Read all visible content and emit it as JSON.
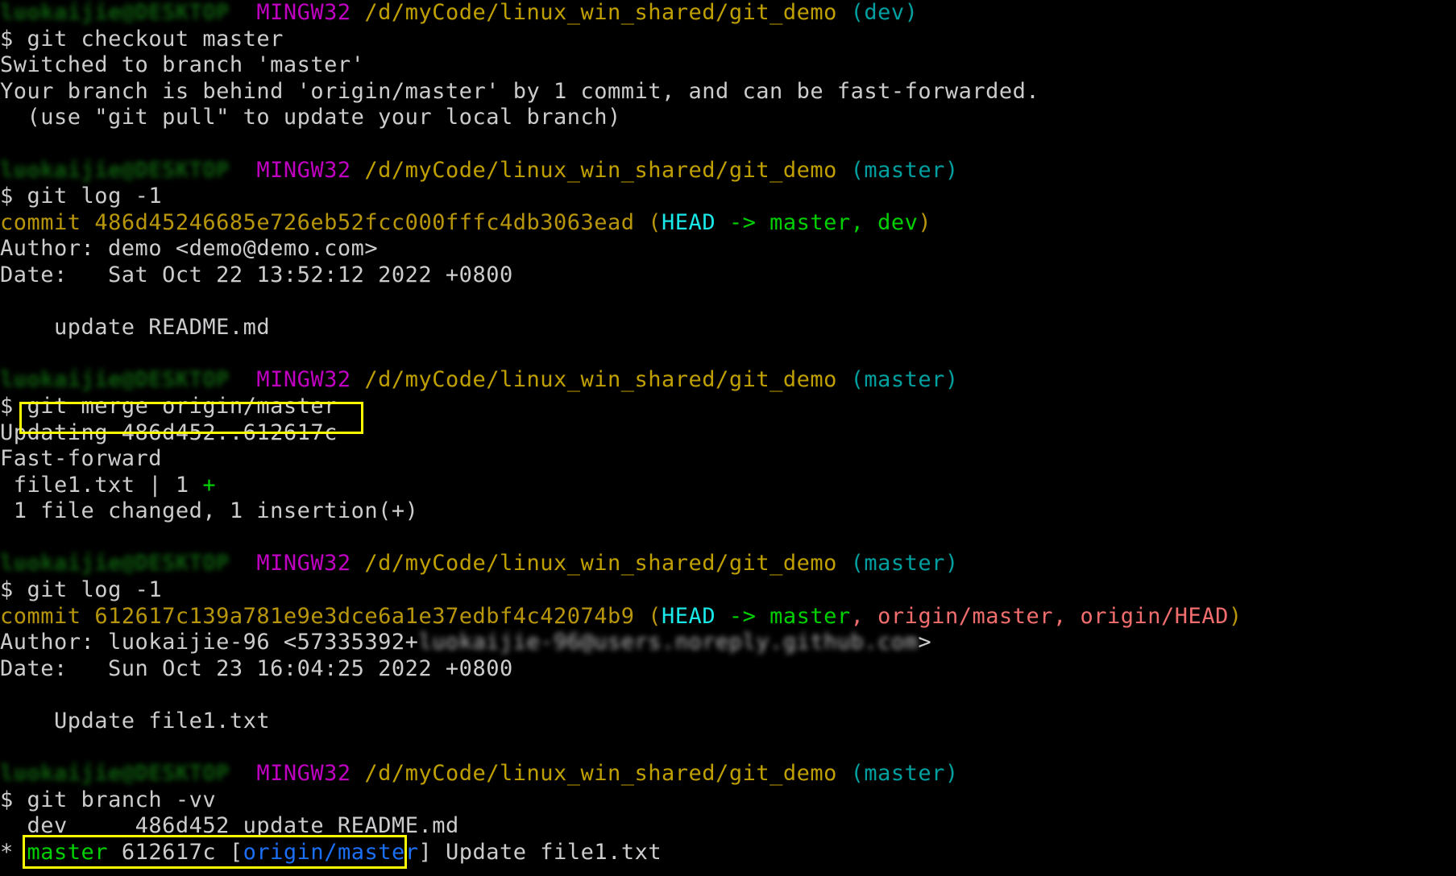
{
  "terminal": {
    "shell": "MINGW32",
    "path": "/d/myCode/linux_win_shared/git_demo",
    "prompt_symbol": "$",
    "redacted_user": "luokaijie@DESKTOP",
    "redacted_email": "luokaijie-96@users.noreply.github.com",
    "colors": {
      "background": "#000000",
      "foreground": "#ccccce",
      "user_green": "#00c000",
      "shell_purple": "#c000c0",
      "path_yellow": "#c0a000",
      "branch_teal": "#00a0a0",
      "commit_olive": "#b8960c",
      "head_cyan": "#18e8e8",
      "local_branch_green": "#00d000",
      "remote_branch_salmon": "#f26d6d",
      "tracking_blue": "#1b6ff5",
      "highlight_box": "#ffff00"
    },
    "annotations": [
      {
        "name": "merge-command-box",
        "label": "git merge origin/master"
      },
      {
        "name": "branch-tracking-box",
        "label": "master 612617c [origin/master]"
      }
    ],
    "blocks": [
      {
        "prompt_branch": "(dev)",
        "command": "git checkout master",
        "output": [
          "Switched to branch 'master'",
          "Your branch is behind 'origin/master' by 1 commit, and can be fast-forwarded.",
          "  (use \"git pull\" to update your local branch)"
        ]
      },
      {
        "prompt_branch": "(master)",
        "command": "git log -1",
        "commit_label": "commit",
        "commit_hash": "486d45246685e726eb52fcc000fffc4db3063ead",
        "refs_open": " (",
        "ref_head": "HEAD",
        "ref_arrow": " -> ",
        "ref_list": "master, dev",
        "refs_close": ")",
        "author_label": "Author: ",
        "author_value": "demo <demo@demo.com>",
        "date_label": "Date:   ",
        "date_value": "Sat Oct 22 13:52:12 2022 +0800",
        "message": "    update README.md"
      },
      {
        "prompt_branch": "(master)",
        "command": "git merge origin/master",
        "output": [
          "Updating 486d452..612617c",
          "Fast-forward",
          " file1.txt | 1 ",
          " 1 file changed, 1 insertion(+)"
        ],
        "diff_plus": "+"
      },
      {
        "prompt_branch": "(master)",
        "command": "git log -1",
        "commit_label": "commit",
        "commit_hash": "612617c139a781e9e3dce6a1e37edbf4c42074b9",
        "refs_open": " (",
        "ref_head": "HEAD",
        "ref_arrow": " -> ",
        "ref_local": "master",
        "ref_sep": ", ",
        "ref_remote1": "origin/master",
        "ref_remote2": "origin/HEAD",
        "refs_close": ")",
        "author_label": "Author: ",
        "author_value": "luokaijie-96 <57335392+",
        "author_tail": ">",
        "date_label": "Date:   ",
        "date_value": "Sun Oct 23 16:04:25 2022 +0800",
        "message": "    Update file1.txt"
      },
      {
        "prompt_branch": "(master)",
        "command": "git branch -vv",
        "branches": [
          {
            "marker": "  ",
            "name": "dev",
            "pad": "     ",
            "sha": "486d452",
            "tracking": "",
            "subject": "update README.md"
          },
          {
            "marker": "* ",
            "name": "master",
            "pad": " ",
            "sha": "612617c",
            "tracking_open": "[",
            "tracking": "origin/master",
            "tracking_close": "]",
            "subject": "Update file1.txt"
          }
        ]
      }
    ]
  }
}
